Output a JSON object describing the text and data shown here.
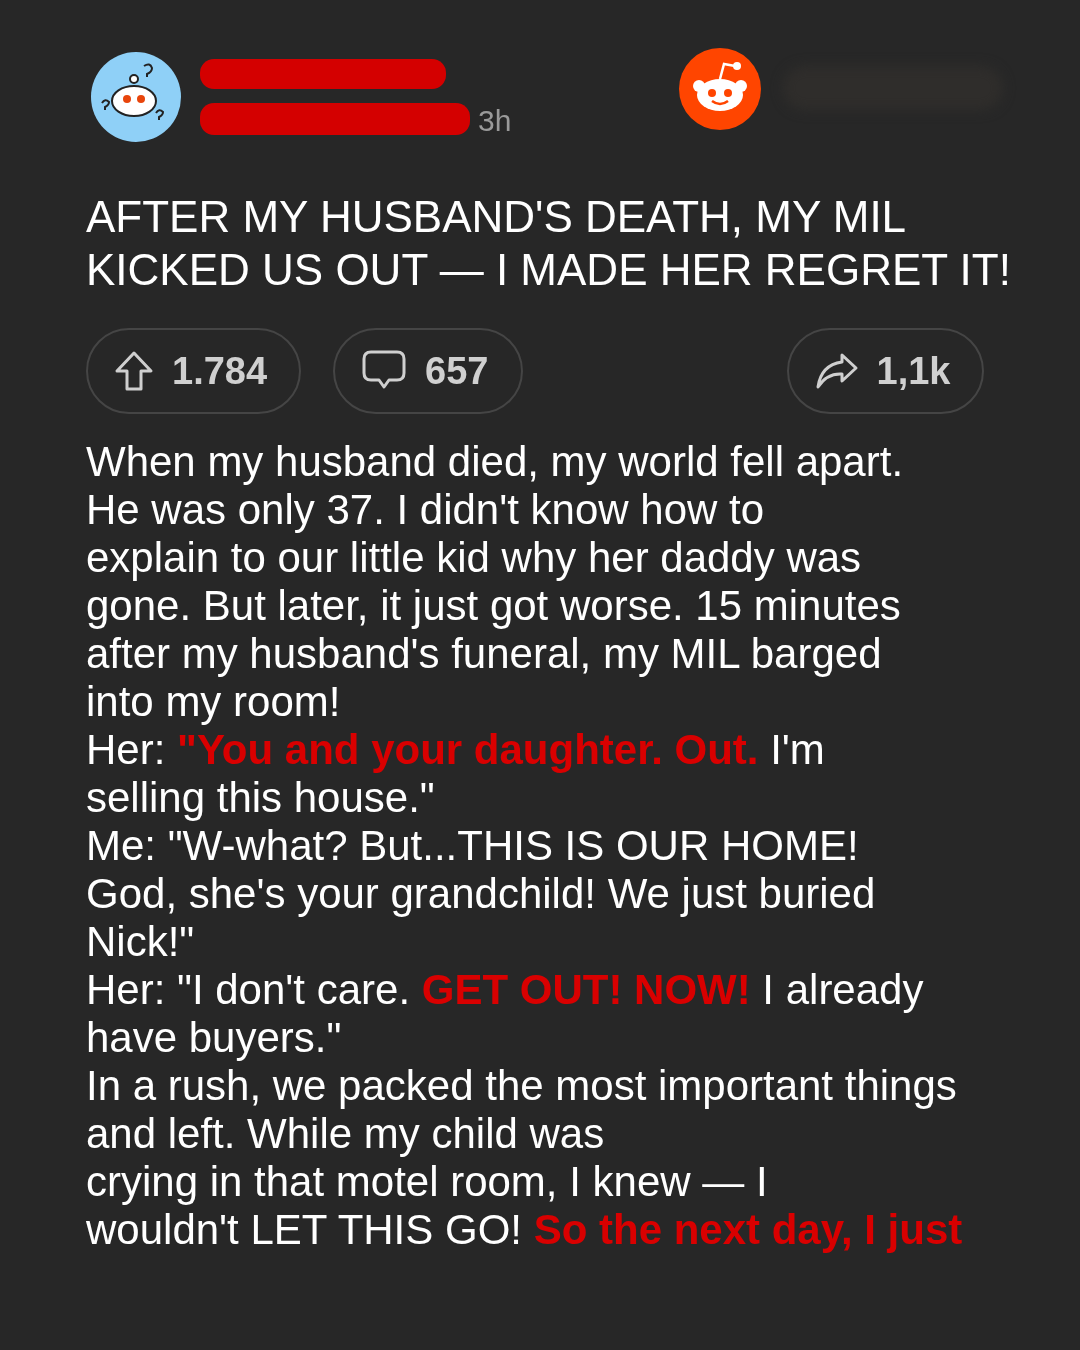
{
  "post": {
    "time": "3h",
    "title": "AFTER MY HUSBAND'S DEATH, MY MIL\nKICKED US OUT — I MADE HER REGRET IT!"
  },
  "actions": [
    {
      "kind": "upvote",
      "label": "1.784"
    },
    {
      "kind": "comment",
      "label": "657"
    },
    {
      "kind": "share",
      "label": "1,1k"
    }
  ],
  "body": [
    "When my husband died, my world fell apart.\nHe was only 37. I didn't know how to\nexplain to our little kid why her daddy was\ngone. But later, it just got worse. 15 minutes\nafter my husband's funeral, my MIL barged\ninto my room!",
    "Her: **\"You and your daughter. Out.** I'm\nselling this house.\"",
    "Me: \"W-what? But...THIS IS OUR HOME!\nGod, she's your grandchild! We just buried\nNick!\"",
    "Her: \"I don't care. **GET OUT! NOW!** I already\nhave buyers.\"",
    "In a rush, we packed the most important things\nand left. While my child was\ncrying in that motel room, I knew — I\nwouldn't LET THIS GO! **So the next day, I just**"
  ]
}
